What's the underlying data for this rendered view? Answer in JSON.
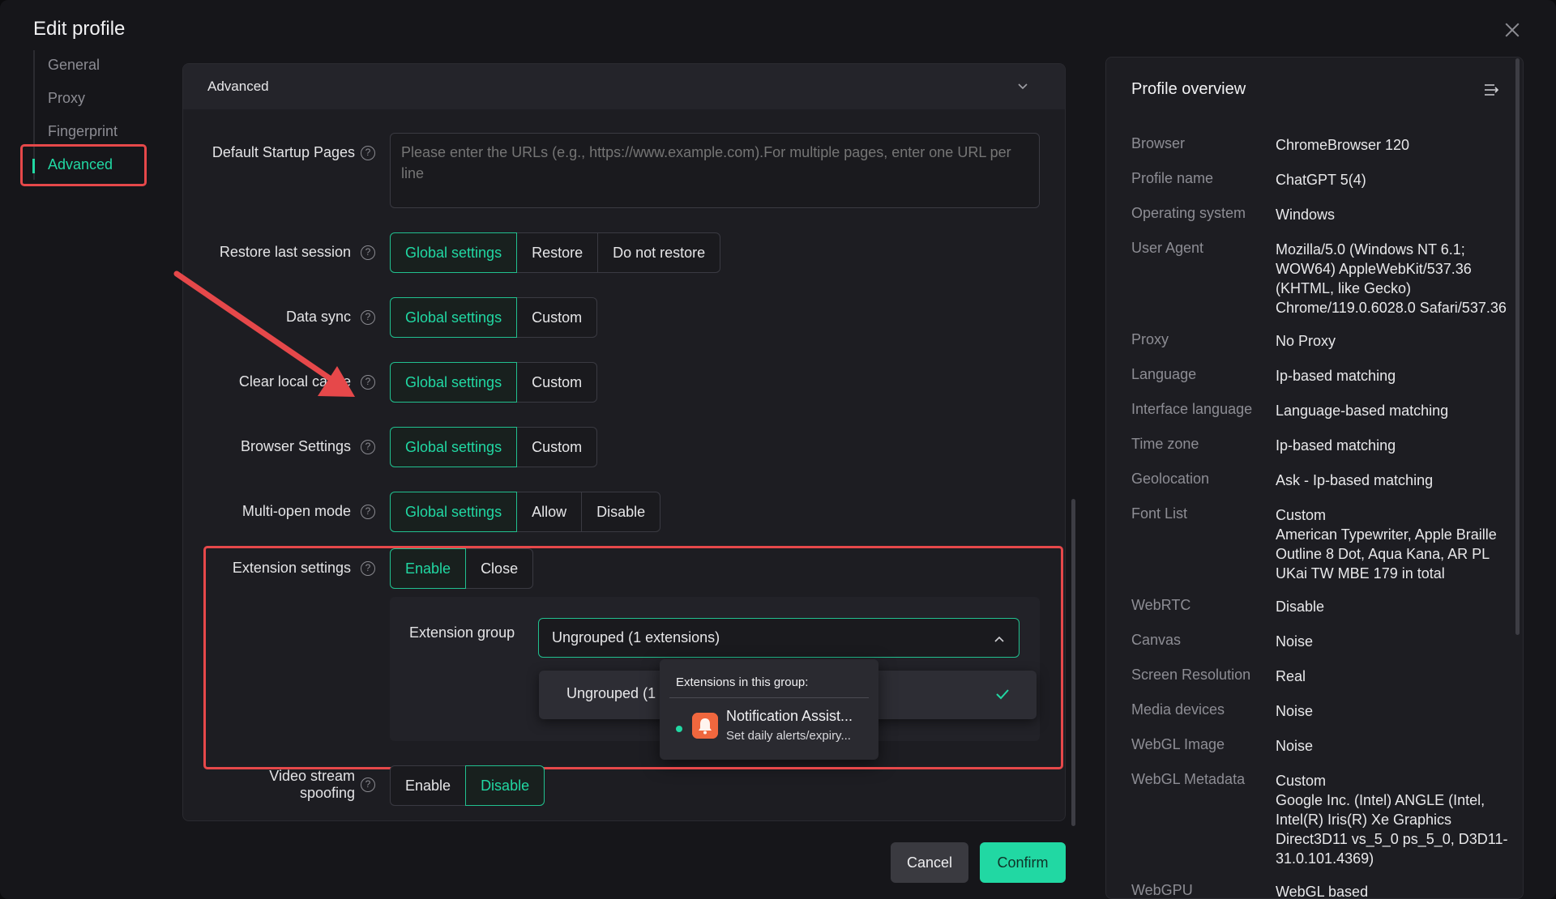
{
  "dialog": {
    "title": "Edit profile"
  },
  "nav": {
    "items": [
      {
        "label": "General"
      },
      {
        "label": "Proxy"
      },
      {
        "label": "Fingerprint"
      },
      {
        "label": "Advanced"
      }
    ]
  },
  "section": {
    "title": "Advanced"
  },
  "startup": {
    "label": "Default Startup Pages",
    "placeholder": "Please enter the URLs (e.g., https://www.example.com).For multiple pages, enter one URL per line"
  },
  "rows": {
    "restore": {
      "label": "Restore last session",
      "options": [
        "Global settings",
        "Restore",
        "Do not restore"
      ],
      "selected": "Global settings"
    },
    "sync": {
      "label": "Data sync",
      "options": [
        "Global settings",
        "Custom"
      ],
      "selected": "Global settings"
    },
    "cache": {
      "label": "Clear local cache",
      "options": [
        "Global settings",
        "Custom"
      ],
      "selected": "Global settings"
    },
    "browser": {
      "label": "Browser Settings",
      "options": [
        "Global settings",
        "Custom"
      ],
      "selected": "Global settings"
    },
    "multiopen": {
      "label": "Multi-open mode",
      "options": [
        "Global settings",
        "Allow",
        "Disable"
      ],
      "selected": "Global settings"
    },
    "extension": {
      "label": "Extension settings",
      "options": [
        "Enable",
        "Close"
      ],
      "selected": "Enable"
    },
    "video": {
      "label_line1": "Video stream",
      "label_line2": "spoofing",
      "options": [
        "Enable",
        "Disable"
      ],
      "selected": "Disable"
    }
  },
  "extension_group": {
    "label": "Extension group",
    "value": "Ungrouped (1 extensions)",
    "dropdown_option": "Ungrouped (1",
    "tooltip": {
      "title": "Extensions in this group:",
      "ext_name": "Notification Assist...",
      "ext_desc": "Set daily alerts/expiry..."
    }
  },
  "footer": {
    "cancel": "Cancel",
    "confirm": "Confirm"
  },
  "overview": {
    "title": "Profile overview",
    "rows": [
      {
        "key": "Browser",
        "value": "ChromeBrowser 120"
      },
      {
        "key": "Profile name",
        "value": "ChatGPT 5(4)"
      },
      {
        "key": "Operating system",
        "value": "Windows"
      },
      {
        "key": "User Agent",
        "value": "Mozilla/5.0 (Windows NT 6.1;\nWOW64) AppleWebKit/537.36\n(KHTML, like Gecko)\nChrome/119.0.6028.0 Safari/537.36"
      },
      {
        "key": "Proxy",
        "value": "No Proxy"
      },
      {
        "key": "Language",
        "value": "Ip-based matching"
      },
      {
        "key": "Interface language",
        "value": "Language-based matching"
      },
      {
        "key": "Time zone",
        "value": "Ip-based matching"
      },
      {
        "key": "Geolocation",
        "value": "Ask - Ip-based matching"
      },
      {
        "key": "Font List",
        "value": "Custom\nAmerican Typewriter, Apple Braille\nOutline 8 Dot, Aqua Kana, AR PL\nUKai TW MBE 179 in total"
      },
      {
        "key": "WebRTC",
        "value": "Disable"
      },
      {
        "key": "Canvas",
        "value": "Noise"
      },
      {
        "key": "Screen Resolution",
        "value": "Real"
      },
      {
        "key": "Media devices",
        "value": "Noise"
      },
      {
        "key": "WebGL Image",
        "value": "Noise"
      },
      {
        "key": "WebGL Metadata",
        "value": "Custom\nGoogle Inc. (Intel) ANGLE (Intel,\nIntel(R) Iris(R) Xe Graphics\nDirect3D11 vs_5_0 ps_5_0, D3D11-\n31.0.101.4369)"
      },
      {
        "key": "WebGPU",
        "value": "WebGL based"
      }
    ]
  },
  "colors": {
    "accent": "#21d8a3",
    "highlight": "#e6484a",
    "background": "#16161a"
  }
}
